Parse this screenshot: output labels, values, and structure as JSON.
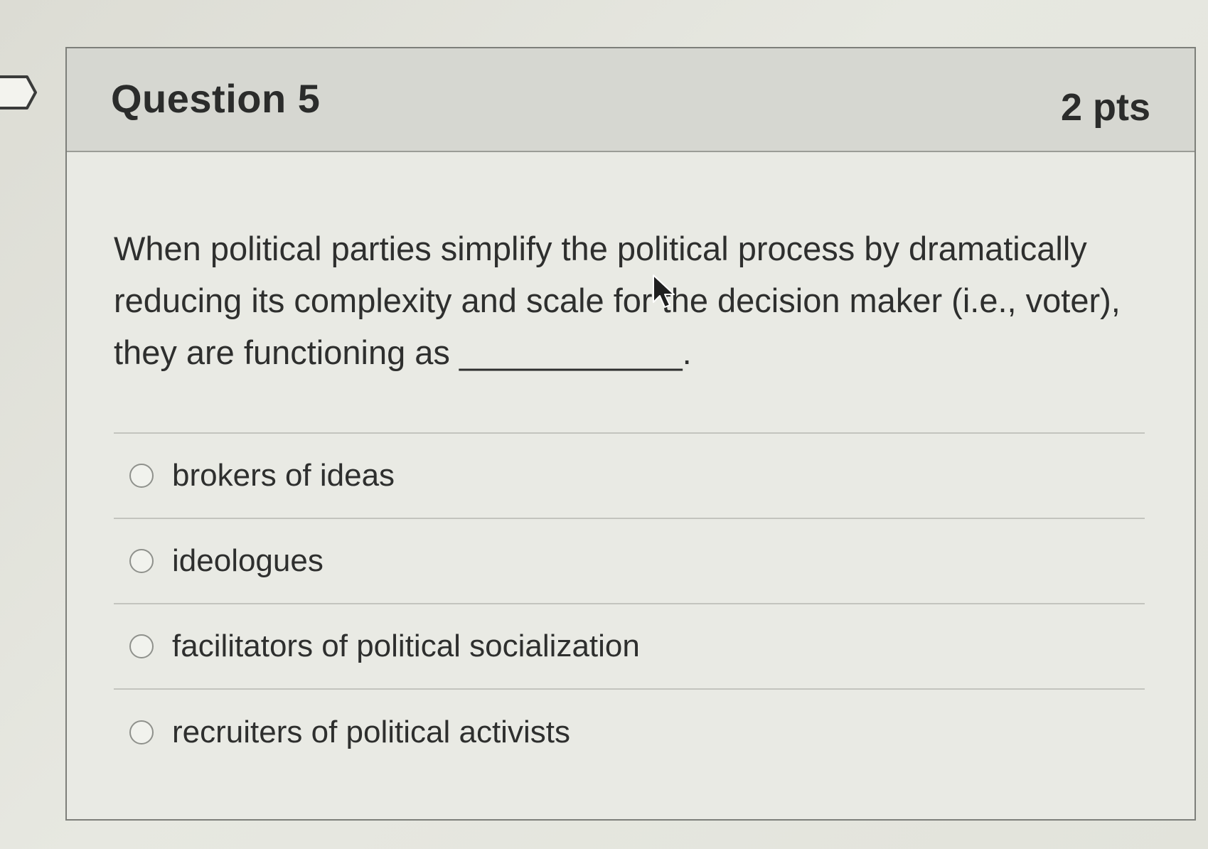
{
  "question": {
    "title": "Question 5",
    "points": "2 pts",
    "text": "When political parties simplify the political process by dramatically reducing its complexity and scale for the decision maker (i.e., voter), they are functioning as ____________."
  },
  "answers": [
    {
      "label": "brokers of ideas"
    },
    {
      "label": "ideologues"
    },
    {
      "label": "facilitators of political socialization"
    },
    {
      "label": "recruiters of political activists"
    }
  ],
  "icons": {
    "flag": "question-flag-icon",
    "cursor": "mouse-pointer-icon"
  },
  "colors": {
    "header_bg": "#d6d7d1",
    "card_bg": "#e9eae4",
    "text": "#2e2f2e"
  }
}
